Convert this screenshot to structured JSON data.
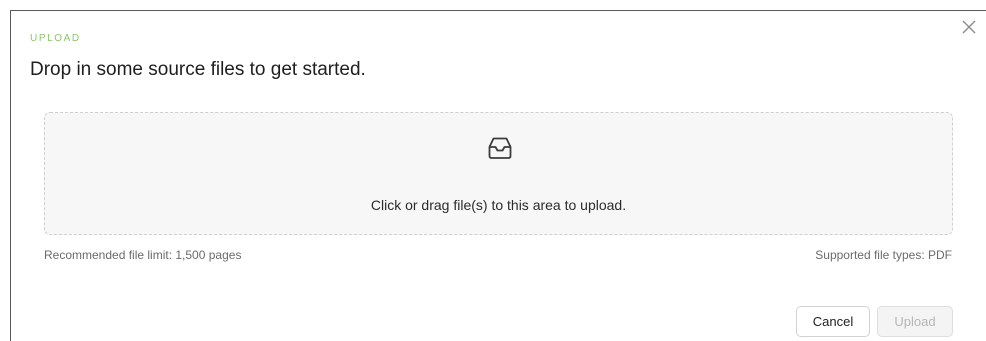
{
  "modal": {
    "eyebrow": "UPLOAD",
    "title": "Drop in some source files to get started.",
    "close_icon": "close-icon"
  },
  "dropzone": {
    "icon": "inbox-icon",
    "text": "Click or drag file(s) to this area to upload."
  },
  "hints": {
    "left": "Recommended file limit: 1,500 pages",
    "right": "Supported file types: PDF"
  },
  "actions": {
    "cancel_label": "Cancel",
    "upload_label": "Upload",
    "upload_disabled": true
  },
  "colors": {
    "accent": "#8dc56a",
    "dropzone_bg": "#f7f7f7",
    "dropzone_border": "#cfcfcf"
  }
}
